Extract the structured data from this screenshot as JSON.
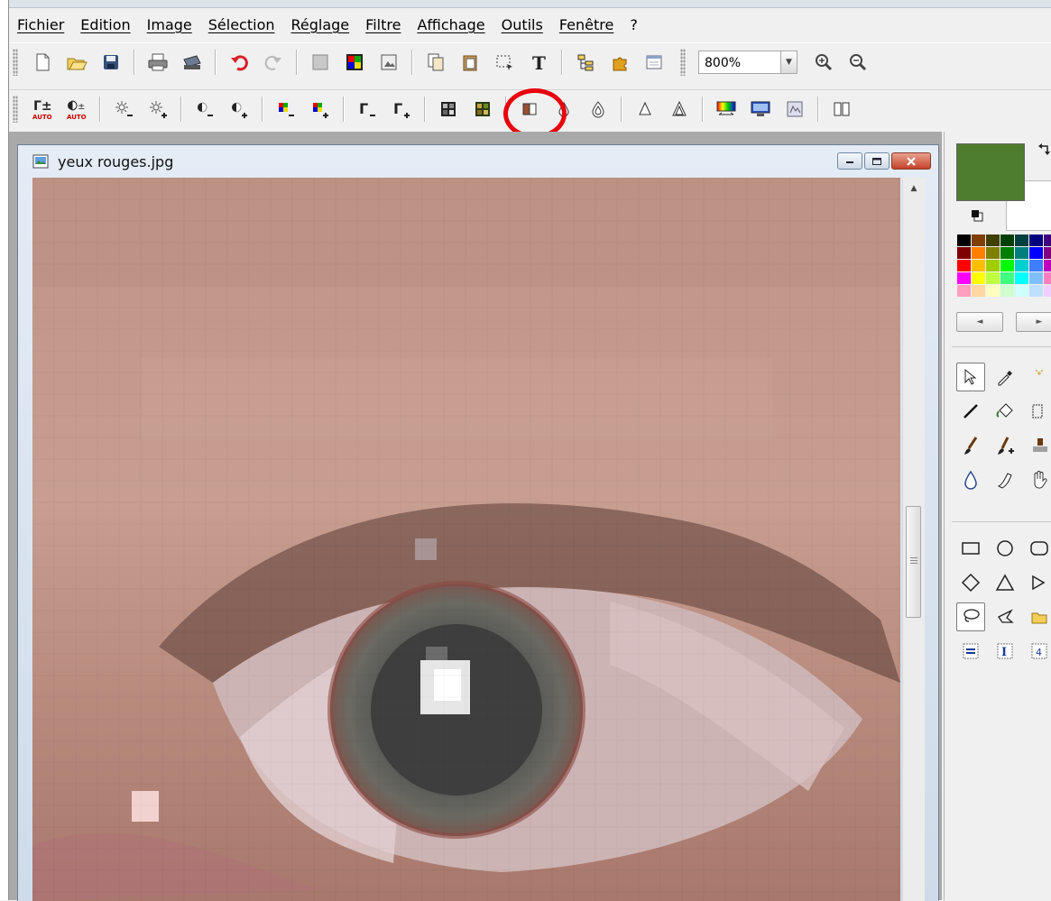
{
  "menu": [
    "Fichier",
    "Edition",
    "Image",
    "Sélection",
    "Réglage",
    "Filtre",
    "Affichage",
    "Outils",
    "Fenêtre",
    "?"
  ],
  "zoom": {
    "value": "800%"
  },
  "document": {
    "title": "yeux rouges.jpg"
  },
  "colors": {
    "foreground": "#4e7d2d",
    "background": "#ffffff",
    "highlight": "#e8000c"
  },
  "palette": [
    "#000000",
    "#7f3f00",
    "#3f3f00",
    "#003f00",
    "#003f3f",
    "#00007f",
    "#3f007f",
    "#7f0000",
    "#ff7f00",
    "#7f7f00",
    "#007f00",
    "#007f7f",
    "#0000ff",
    "#7f007f",
    "#ff0000",
    "#ffbf00",
    "#9fcf00",
    "#00ff00",
    "#00cfcf",
    "#3f7fff",
    "#bf00bf",
    "#ff00ff",
    "#ffff00",
    "#bfff3f",
    "#3fff7f",
    "#00ffff",
    "#7fbfff",
    "#ff7fbf",
    "#ff9fbf",
    "#ffd7a0",
    "#ffffbf",
    "#cfffcf",
    "#cfffff",
    "#bfdfff",
    "#efcfff"
  ],
  "toolbar1_icons": [
    "new-file-icon",
    "open-folder-icon",
    "save-icon",
    "print-icon",
    "scan-icon",
    "undo-icon",
    "redo-icon",
    "gray-square-icon",
    "color-grid-icon",
    "image-frame-icon",
    "copy-icon",
    "paste-icon",
    "select-area-icon",
    "text-tool-icon",
    "tree-icon",
    "puzzle-icon",
    "window-icon",
    "zoom-in-icon",
    "zoom-out-icon"
  ],
  "toolbar2_icons": [
    "gamma-auto-icon",
    "contrast-auto-icon",
    "brightness-down-icon",
    "brightness-up-icon",
    "contrast-down-icon",
    "contrast-up-icon",
    "saturation-down-icon",
    "saturation-up-icon",
    "gamma-down-icon",
    "gamma-up-icon",
    "grayscale-grid-icon",
    "sepia-grid-icon",
    "mirror-icon",
    "sharpen-icon",
    "sharpen-more-icon",
    "blur-icon",
    "blur-more-icon",
    "equalize-icon",
    "monitor-icon",
    "noise-icon",
    "flip-icon"
  ],
  "tools": [
    "select-arrow-icon",
    "eyedropper-icon",
    "magic-wand-icon",
    "line-icon",
    "bucket-icon",
    "text-tool-icon",
    "brush-icon",
    "brush-plus-icon",
    "stamp-icon",
    "drop-icon",
    "smudge-icon",
    "hand-icon",
    "rectangle-icon",
    "ellipse-icon",
    "rounded-rect-icon",
    "diamond-icon",
    "triangle-icon",
    "arrow-shape-icon",
    "lasso-icon",
    "polygon-lasso-icon",
    "folder-shape-icon",
    "line-style-icon",
    "text-cursor-icon",
    "number-icon"
  ]
}
